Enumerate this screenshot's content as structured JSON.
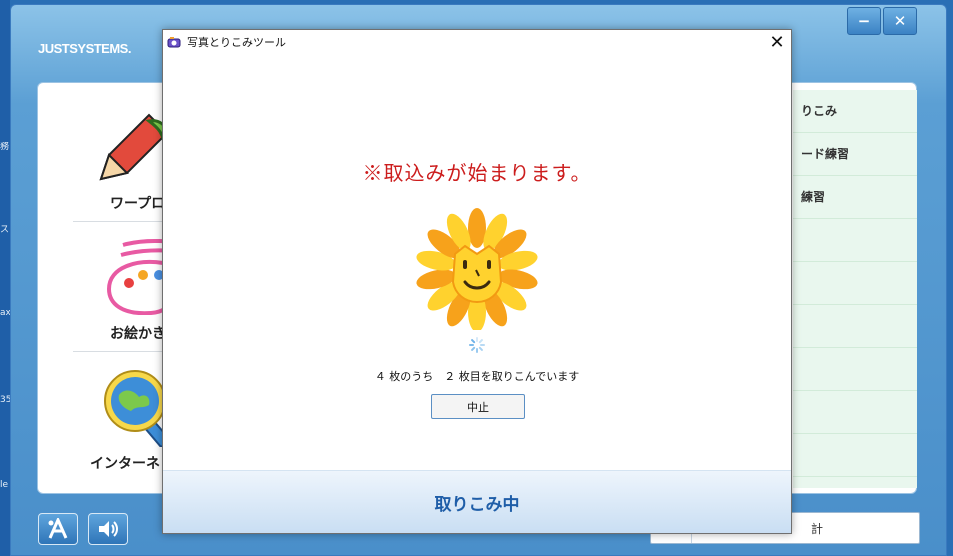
{
  "app": {
    "brand": "JUSTSYSTEMS",
    "window_controls": {
      "minimize_glyph": "−",
      "close_glyph": "✕"
    }
  },
  "left_edge_glyphs": [
    "務",
    "ス",
    "ax",
    "35",
    "le"
  ],
  "menu": {
    "items": [
      {
        "label": "ワープロ",
        "icon": "pencil-sprout-icon"
      },
      {
        "label": "お絵かき",
        "icon": "paint-palette-icon"
      },
      {
        "label": "インターネ",
        "icon": "globe-magnifier-icon"
      }
    ]
  },
  "right_list": {
    "items": [
      "りこみ",
      "ード練習",
      "練習",
      "",
      "",
      "",
      "",
      "",
      ""
    ]
  },
  "bottom_bar": {
    "search_suffix": "計"
  },
  "dialog": {
    "title": "写真とりこみツール",
    "close_glyph": "✕",
    "message": "※取込みが始まります。",
    "progress": "４ 枚のうち　２ 枚目を取りこんでいます",
    "images_total": 4,
    "images_current": 2,
    "stop_label": "中止",
    "footer_status": "取りこみ中",
    "colors": {
      "message": "#cc1d1d",
      "footer_text": "#1f5ea8",
      "sun_outer": "#f7a21b",
      "sun_inner": "#ffd22e"
    }
  }
}
